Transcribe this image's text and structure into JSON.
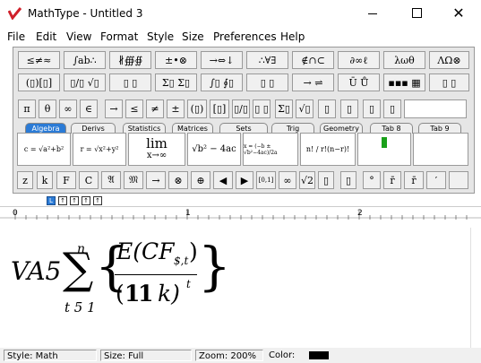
{
  "window": {
    "title": "MathType - Untitled 3"
  },
  "menu": [
    "File",
    "Edit",
    "View",
    "Format",
    "Style",
    "Size",
    "Preferences",
    "Help"
  ],
  "symbol_row1": [
    "≤≠≈",
    "∫ab∴",
    "∦∰∯",
    "±•⊗",
    "→⇔↓",
    "∴∀∃",
    "∉∩⊂",
    "∂∞ℓ",
    "λωθ",
    "ΛΩ⊗"
  ],
  "symbol_row2": [
    "(▯)[▯]",
    "▯/▯ √▯",
    "▯ ▯",
    "Σ▯ Σ▯",
    "∫▯ ∮▯",
    "▯ ▯",
    "→ ⇌",
    "Ū Ů",
    "▪▪▪ ▦",
    "▯ ▯"
  ],
  "small_bar": [
    "π",
    "θ",
    "∞",
    "∈",
    "→",
    "≤",
    "≠",
    "±",
    "(▯)",
    "[▯]",
    "▯/▯",
    "▯ ▯",
    "Σ▯",
    "√▯",
    "▯",
    "▯",
    "▯",
    "▯"
  ],
  "tabs": [
    "Algebra",
    "Derivs",
    "Statistics",
    "Matrices",
    "Sets",
    "Trig",
    "Geometry",
    "Tab 8",
    "Tab 9"
  ],
  "templates": [
    "c = √a²+b²",
    "r = √x²+y²",
    "lim x→∞",
    "√b² − 4ac",
    "x = (−b ± √b²−4ac)/2a",
    "n! / r!(n−r)!"
  ],
  "template_lim": {
    "top": "lim",
    "bottom": "x→∞"
  },
  "bottom_bar": [
    "z",
    "k",
    "F",
    "C",
    "𝔄",
    "𝔐",
    "→",
    "⊗",
    "⊕",
    "◀",
    "▶",
    "[0,1]",
    "∞",
    "√2",
    "▯",
    "▯",
    "°",
    "r̄",
    "r̄",
    "′"
  ],
  "size_buttons": [
    "L",
    "↑",
    "↑",
    "↑",
    "↑"
  ],
  "ruler": {
    "marks": [
      "0",
      "1",
      "2"
    ]
  },
  "equation": {
    "lhs": "VA5",
    "sum_upper": "n",
    "sum_lower": "t 5 1",
    "num_main": "E(CF",
    "num_sub": "$,t",
    "num_close": ")",
    "den_open": "(",
    "den_one": "1",
    "den_one2": "1",
    "den_k": "k)",
    "den_exp": "t"
  },
  "status": {
    "style": "Style: Math",
    "size": "Size: Full",
    "zoom": "Zoom: 200%",
    "color_label": "Color:",
    "color_value": "#000000"
  },
  "colors": {
    "accent": "#2b7bd6",
    "logo": "#d0202a",
    "template_green": "#1aa01a"
  }
}
